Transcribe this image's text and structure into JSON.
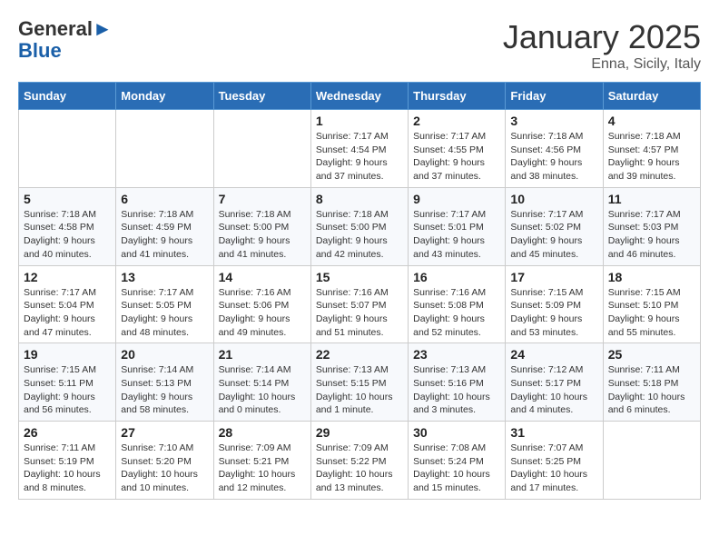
{
  "header": {
    "logo_general": "General",
    "logo_blue": "Blue",
    "month_year": "January 2025",
    "location": "Enna, Sicily, Italy"
  },
  "weekdays": [
    "Sunday",
    "Monday",
    "Tuesday",
    "Wednesday",
    "Thursday",
    "Friday",
    "Saturday"
  ],
  "weeks": [
    [
      {
        "day": "",
        "info": ""
      },
      {
        "day": "",
        "info": ""
      },
      {
        "day": "",
        "info": ""
      },
      {
        "day": "1",
        "info": "Sunrise: 7:17 AM\nSunset: 4:54 PM\nDaylight: 9 hours and 37 minutes."
      },
      {
        "day": "2",
        "info": "Sunrise: 7:17 AM\nSunset: 4:55 PM\nDaylight: 9 hours and 37 minutes."
      },
      {
        "day": "3",
        "info": "Sunrise: 7:18 AM\nSunset: 4:56 PM\nDaylight: 9 hours and 38 minutes."
      },
      {
        "day": "4",
        "info": "Sunrise: 7:18 AM\nSunset: 4:57 PM\nDaylight: 9 hours and 39 minutes."
      }
    ],
    [
      {
        "day": "5",
        "info": "Sunrise: 7:18 AM\nSunset: 4:58 PM\nDaylight: 9 hours and 40 minutes."
      },
      {
        "day": "6",
        "info": "Sunrise: 7:18 AM\nSunset: 4:59 PM\nDaylight: 9 hours and 41 minutes."
      },
      {
        "day": "7",
        "info": "Sunrise: 7:18 AM\nSunset: 5:00 PM\nDaylight: 9 hours and 41 minutes."
      },
      {
        "day": "8",
        "info": "Sunrise: 7:18 AM\nSunset: 5:00 PM\nDaylight: 9 hours and 42 minutes."
      },
      {
        "day": "9",
        "info": "Sunrise: 7:17 AM\nSunset: 5:01 PM\nDaylight: 9 hours and 43 minutes."
      },
      {
        "day": "10",
        "info": "Sunrise: 7:17 AM\nSunset: 5:02 PM\nDaylight: 9 hours and 45 minutes."
      },
      {
        "day": "11",
        "info": "Sunrise: 7:17 AM\nSunset: 5:03 PM\nDaylight: 9 hours and 46 minutes."
      }
    ],
    [
      {
        "day": "12",
        "info": "Sunrise: 7:17 AM\nSunset: 5:04 PM\nDaylight: 9 hours and 47 minutes."
      },
      {
        "day": "13",
        "info": "Sunrise: 7:17 AM\nSunset: 5:05 PM\nDaylight: 9 hours and 48 minutes."
      },
      {
        "day": "14",
        "info": "Sunrise: 7:16 AM\nSunset: 5:06 PM\nDaylight: 9 hours and 49 minutes."
      },
      {
        "day": "15",
        "info": "Sunrise: 7:16 AM\nSunset: 5:07 PM\nDaylight: 9 hours and 51 minutes."
      },
      {
        "day": "16",
        "info": "Sunrise: 7:16 AM\nSunset: 5:08 PM\nDaylight: 9 hours and 52 minutes."
      },
      {
        "day": "17",
        "info": "Sunrise: 7:15 AM\nSunset: 5:09 PM\nDaylight: 9 hours and 53 minutes."
      },
      {
        "day": "18",
        "info": "Sunrise: 7:15 AM\nSunset: 5:10 PM\nDaylight: 9 hours and 55 minutes."
      }
    ],
    [
      {
        "day": "19",
        "info": "Sunrise: 7:15 AM\nSunset: 5:11 PM\nDaylight: 9 hours and 56 minutes."
      },
      {
        "day": "20",
        "info": "Sunrise: 7:14 AM\nSunset: 5:13 PM\nDaylight: 9 hours and 58 minutes."
      },
      {
        "day": "21",
        "info": "Sunrise: 7:14 AM\nSunset: 5:14 PM\nDaylight: 10 hours and 0 minutes."
      },
      {
        "day": "22",
        "info": "Sunrise: 7:13 AM\nSunset: 5:15 PM\nDaylight: 10 hours and 1 minute."
      },
      {
        "day": "23",
        "info": "Sunrise: 7:13 AM\nSunset: 5:16 PM\nDaylight: 10 hours and 3 minutes."
      },
      {
        "day": "24",
        "info": "Sunrise: 7:12 AM\nSunset: 5:17 PM\nDaylight: 10 hours and 4 minutes."
      },
      {
        "day": "25",
        "info": "Sunrise: 7:11 AM\nSunset: 5:18 PM\nDaylight: 10 hours and 6 minutes."
      }
    ],
    [
      {
        "day": "26",
        "info": "Sunrise: 7:11 AM\nSunset: 5:19 PM\nDaylight: 10 hours and 8 minutes."
      },
      {
        "day": "27",
        "info": "Sunrise: 7:10 AM\nSunset: 5:20 PM\nDaylight: 10 hours and 10 minutes."
      },
      {
        "day": "28",
        "info": "Sunrise: 7:09 AM\nSunset: 5:21 PM\nDaylight: 10 hours and 12 minutes."
      },
      {
        "day": "29",
        "info": "Sunrise: 7:09 AM\nSunset: 5:22 PM\nDaylight: 10 hours and 13 minutes."
      },
      {
        "day": "30",
        "info": "Sunrise: 7:08 AM\nSunset: 5:24 PM\nDaylight: 10 hours and 15 minutes."
      },
      {
        "day": "31",
        "info": "Sunrise: 7:07 AM\nSunset: 5:25 PM\nDaylight: 10 hours and 17 minutes."
      },
      {
        "day": "",
        "info": ""
      }
    ]
  ]
}
